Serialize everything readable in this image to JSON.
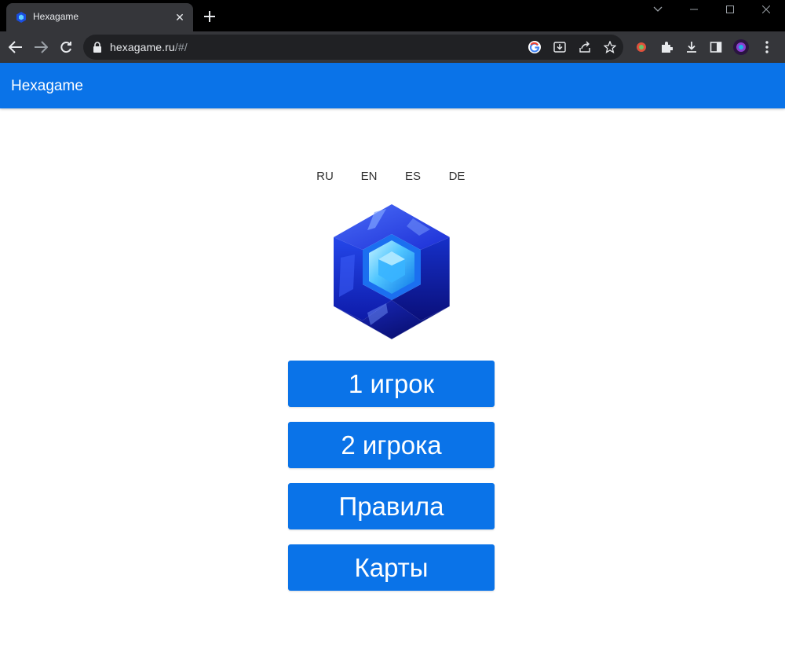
{
  "browser": {
    "tab_title": "Hexagame",
    "url_host": "hexagame.ru",
    "url_path": "/#/"
  },
  "app": {
    "title": "Hexagame"
  },
  "languages": [
    "RU",
    "EN",
    "ES",
    "DE"
  ],
  "menu": {
    "one_player": "1 игрок",
    "two_players": "2 игрока",
    "rules": "Правила",
    "maps": "Карты"
  },
  "colors": {
    "brand_blue": "#0a73e8",
    "chrome_dark": "#35363a",
    "tab_strip": "#000000"
  }
}
